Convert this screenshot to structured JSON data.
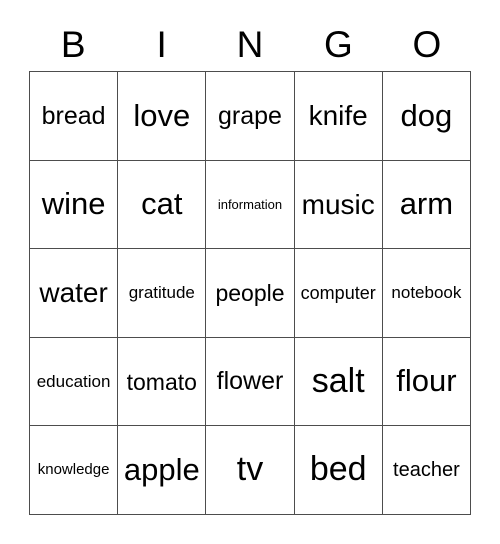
{
  "card": {
    "title_letters": [
      "B",
      "I",
      "N",
      "G",
      "O"
    ],
    "columns": 5,
    "rows": 5,
    "grid_line_color": "#4d4d4d",
    "text_color": "#000000",
    "background_color": "#ffffff",
    "cells": [
      [
        {
          "label": "bread",
          "size": 25
        },
        {
          "label": "love",
          "size": 31
        },
        {
          "label": "grape",
          "size": 25
        },
        {
          "label": "knife",
          "size": 28
        },
        {
          "label": "dog",
          "size": 31
        }
      ],
      [
        {
          "label": "wine",
          "size": 31
        },
        {
          "label": "cat",
          "size": 31
        },
        {
          "label": "information",
          "size": 13
        },
        {
          "label": "music",
          "size": 28
        },
        {
          "label": "arm",
          "size": 31
        }
      ],
      [
        {
          "label": "water",
          "size": 28
        },
        {
          "label": "gratitude",
          "size": 17
        },
        {
          "label": "people",
          "size": 23
        },
        {
          "label": "computer",
          "size": 18
        },
        {
          "label": "notebook",
          "size": 17
        }
      ],
      [
        {
          "label": "education",
          "size": 17
        },
        {
          "label": "tomato",
          "size": 23
        },
        {
          "label": "flower",
          "size": 25
        },
        {
          "label": "salt",
          "size": 34
        },
        {
          "label": "flour",
          "size": 31
        }
      ],
      [
        {
          "label": "knowledge",
          "size": 15
        },
        {
          "label": "apple",
          "size": 31
        },
        {
          "label": "tv",
          "size": 34
        },
        {
          "label": "bed",
          "size": 34
        },
        {
          "label": "teacher",
          "size": 20
        }
      ]
    ]
  }
}
